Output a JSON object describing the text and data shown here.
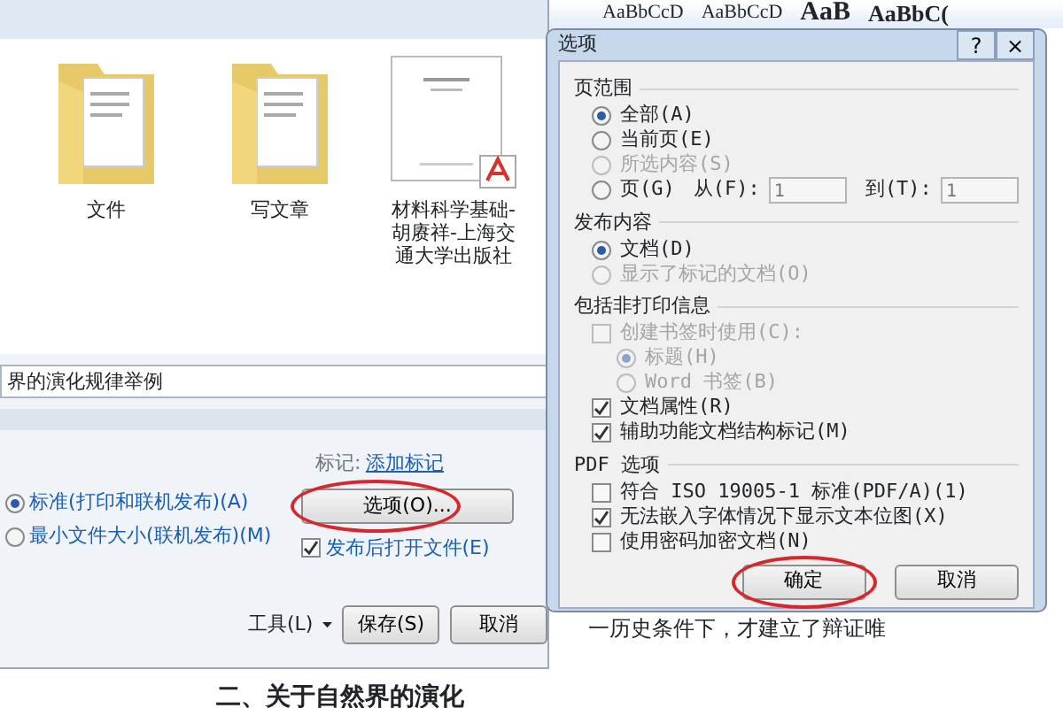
{
  "background_document": {
    "ribbon_styles": [
      {
        "label": "AaBbCcD",
        "kind": "small"
      },
      {
        "label": "AaBbCcD",
        "kind": "small"
      },
      {
        "label": "AaB",
        "kind": "large"
      },
      {
        "label": "AaBbC(",
        "kind": "medium"
      }
    ],
    "text_lines": [
      {
        "text": "一历史条件下，才建立了辩证唯",
        "kind": "body"
      },
      {
        "text": "二、关于自然界的演化",
        "kind": "heading"
      }
    ]
  },
  "save_dialog": {
    "files": [
      {
        "name": "文件",
        "kind": "folder"
      },
      {
        "name": "写文章",
        "kind": "folder"
      },
      {
        "name": "材料科学基础-胡赓祥-上海交通大学出版社",
        "kind": "pdf"
      }
    ],
    "file_name": "界的演化规律举例",
    "tags_label": "标记:",
    "tags_link": "添加标记",
    "optimize": [
      {
        "label": "标准(打印和联机发布)(A)",
        "selected": true
      },
      {
        "label": "最小文件大小(联机发布)(M)",
        "selected": false
      }
    ],
    "options_button": {
      "label": "选项(O)...",
      "highlighted": true
    },
    "open_after": {
      "label": "发布后打开文件(E)",
      "checked": true
    },
    "tools": "工具(L)",
    "buttons": [
      {
        "label": "保存(S)"
      },
      {
        "label": "取消"
      }
    ]
  },
  "options_dialog": {
    "title": "选项",
    "help": "?",
    "close": "×",
    "sections": [
      {
        "title": "页范围",
        "items": [
          {
            "kind": "radio",
            "label": "全部(A)",
            "selected": true,
            "disabled": false
          },
          {
            "kind": "radio",
            "label": "当前页(E)",
            "selected": false,
            "disabled": false
          },
          {
            "kind": "radio",
            "label": "所选内容(S)",
            "selected": false,
            "disabled": true
          },
          {
            "kind": "range",
            "label": "页(G)",
            "selected": false,
            "disabled": false,
            "from_label": "从(F):",
            "from_value": "1",
            "to_label": "到(T):",
            "to_value": "1"
          }
        ]
      },
      {
        "title": "发布内容",
        "items": [
          {
            "kind": "radio",
            "label": "文档(D)",
            "selected": true,
            "disabled": false
          },
          {
            "kind": "radio",
            "label": "显示了标记的文档(O)",
            "selected": false,
            "disabled": true
          }
        ]
      },
      {
        "title": "包括非打印信息",
        "items": [
          {
            "kind": "checkbox",
            "label": "创建书签时使用(C):",
            "checked": false,
            "disabled": true,
            "children": [
              {
                "kind": "radio",
                "label": "标题(H)",
                "selected": true,
                "disabled": true
              },
              {
                "kind": "radio",
                "label": "Word 书签(B)",
                "selected": false,
                "disabled": true
              }
            ]
          },
          {
            "kind": "checkbox",
            "label": "文档属性(R)",
            "checked": true,
            "disabled": false
          },
          {
            "kind": "checkbox",
            "label": "辅助功能文档结构标记(M)",
            "checked": true,
            "disabled": false
          }
        ]
      },
      {
        "title": "PDF 选项",
        "items": [
          {
            "kind": "checkbox",
            "label": "符合 ISO 19005-1 标准(PDF/A)(1)",
            "checked": false,
            "disabled": false
          },
          {
            "kind": "checkbox",
            "label": "无法嵌入字体情况下显示文本位图(X)",
            "checked": true,
            "disabled": false
          },
          {
            "kind": "checkbox",
            "label": "使用密码加密文档(N)",
            "checked": false,
            "disabled": false
          }
        ]
      }
    ],
    "buttons": [
      {
        "label": "确定",
        "highlighted": true
      },
      {
        "label": "取消",
        "highlighted": false
      }
    ]
  }
}
